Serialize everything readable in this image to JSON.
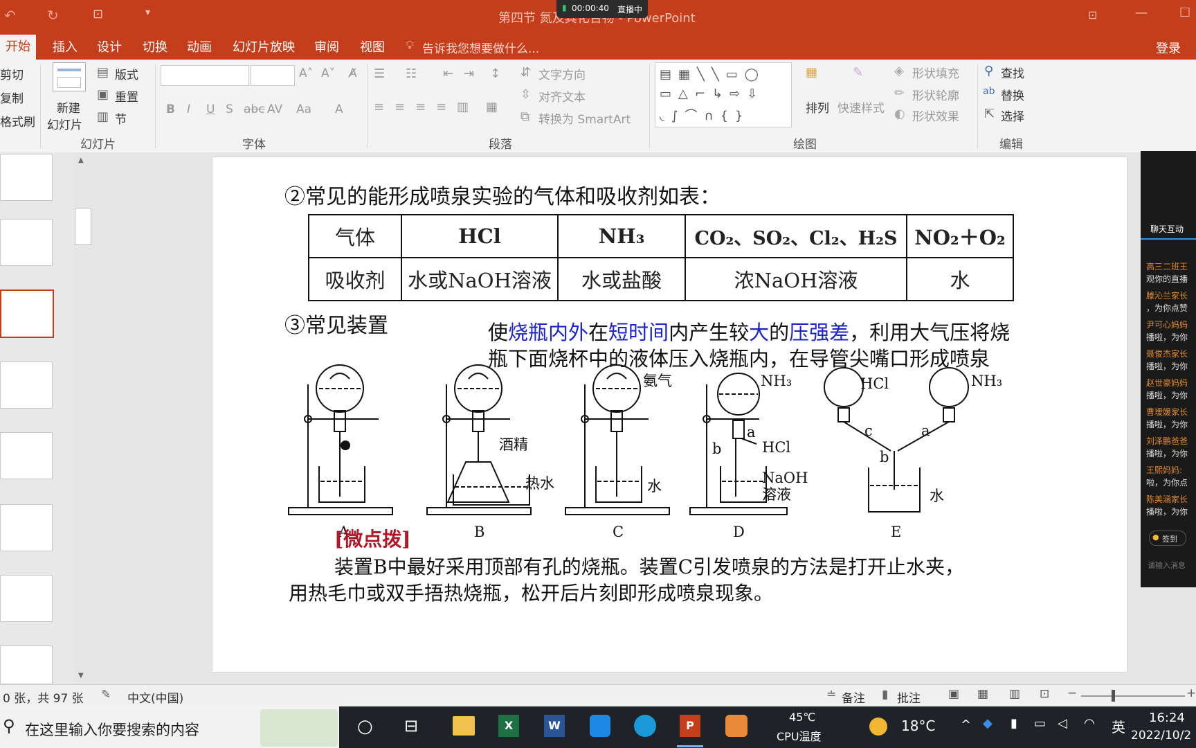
{
  "window": {
    "title": "第四节 氮及其化合物 - PowerPoint",
    "recording_time": "00:00:40",
    "live_label": "直播中"
  },
  "tabs": [
    "开始",
    "插入",
    "设计",
    "切换",
    "动画",
    "幻灯片放映",
    "审阅",
    "视图"
  ],
  "tell_me": "告诉我您想要做什么...",
  "login": "登录",
  "ribbon": {
    "clipboard": {
      "cut": "剪切",
      "copy": "复制",
      "format_painter": "格式刷"
    },
    "slides": {
      "new_slide": "新建",
      "new_slide2": "幻灯片",
      "layout": "版式",
      "reset": "重置",
      "section": "节",
      "label": "幻灯片"
    },
    "font": {
      "label": "字体",
      "bold": "B",
      "italic": "I",
      "underline": "U",
      "shadow": "S",
      "strike": "abc",
      "spacing": "AV",
      "case": "Aa",
      "color": "A"
    },
    "paragraph": {
      "label": "段落",
      "text_direction": "文字方向",
      "align_text": "对齐文本",
      "smartart": "转换为 SmartArt"
    },
    "drawing": {
      "label": "绘图",
      "arrange": "排列",
      "quick_styles": "快速样式",
      "shape_fill": "形状填充",
      "shape_outline": "形状轮廓",
      "shape_effects": "形状效果"
    },
    "editing": {
      "label": "编辑",
      "find": "查找",
      "replace": "替换",
      "select": "选择"
    }
  },
  "slide": {
    "heading2": "②常见的能形成喷泉实验的气体和吸收剂如表：",
    "table": {
      "row1": [
        "气体",
        "HCl",
        "NH₃",
        "CO₂、SO₂、Cl₂、H₂S",
        "NO₂＋O₂"
      ],
      "row2": [
        "吸收剂",
        "水或NaOH溶液",
        "水或盐酸",
        "浓NaOH溶液",
        "水"
      ]
    },
    "heading3": "③常见装置",
    "principle_parts": [
      "使",
      "烧瓶内外",
      "在",
      "短时间",
      "内产生较",
      "大",
      "的",
      "压强差",
      "，利用大气压将烧"
    ],
    "principle_line2": "瓶下面烧杯中的液体压入烧瓶内，在导管尖嘴口形成喷泉",
    "apparatus_labels": {
      "A": "A",
      "B": "B",
      "C": "C",
      "D": "D",
      "E": "E",
      "alcohol": "酒精",
      "hot_water": "热水",
      "ammonia": "氨气",
      "water": "水",
      "nh3": "NH₃",
      "hcl": "HCl",
      "naoh1": "NaOH",
      "naoh2": "溶液",
      "a": "a",
      "b": "b",
      "c": "c"
    },
    "tip_title": "[微点拨]",
    "tip_line1": "装置B中最好采用顶部有孔的烧瓶。装置C引发喷泉的方法是打开止水夹，",
    "tip_line2": "用热毛巾或双手捂热烧瓶，松开后片刻即形成喷泉现象。"
  },
  "side_panel": {
    "tab": "聊天互动",
    "messages": [
      "高三二班王",
      "观你的直播",
      "滕沁兰家长",
      "，为你点赞",
      "尹可心妈妈",
      "播啦，为你",
      "聂俊杰家长",
      "播啦，为你",
      "赵世豪妈妈",
      "播啦，为你",
      "曹瑷媛家长",
      "播啦，为你",
      "刘泽鹏爸爸",
      "播啦，为你",
      "王熙妈妈:",
      "啦，为你点",
      "陈美涵家长",
      "播啦，为你"
    ],
    "sign_in": "签到",
    "input_hint": "请输入消息"
  },
  "status_bar": {
    "slide_count": "0 张，共 97 张",
    "language": "中文(中国)",
    "notes": "备注",
    "comments": "批注"
  },
  "taskbar": {
    "search_placeholder": "在这里输入你要搜索的内容",
    "cpu_temp": "45℃",
    "cpu_label": "CPU温度",
    "weather_temp": "18°C",
    "ime": "英",
    "time": "16:24",
    "date": "2022/10/2"
  }
}
